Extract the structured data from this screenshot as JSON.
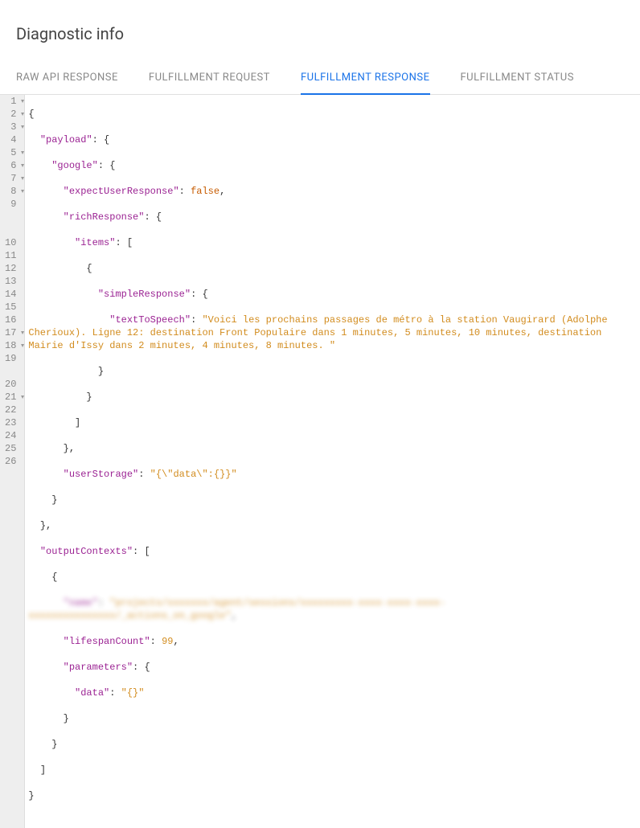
{
  "header": {
    "title": "Diagnostic info"
  },
  "tabs": [
    {
      "label": "RAW API RESPONSE",
      "active": false
    },
    {
      "label": "FULFILLMENT REQUEST",
      "active": false
    },
    {
      "label": "FULFILLMENT RESPONSE",
      "active": true
    },
    {
      "label": "FULFILLMENT STATUS",
      "active": false
    }
  ],
  "code": {
    "response": {
      "payload": {
        "google": {
          "expectUserResponse": false,
          "richResponse": {
            "items": [
              {
                "simpleResponse": {
                  "textToSpeech": "Voici les prochains passages de métro à la station Vaugirard (Adolphe Cherioux). Ligne 12: destination Front Populaire dans 1 minutes, 5 minutes, 10 minutes, destination Mairie d'Issy dans 2 minutes, 4 minutes, 8 minutes. "
                }
              }
            ]
          },
          "userStorage": "{\\\"data\\\":{}}"
        }
      },
      "outputContexts": [
        {
          "name_blurred": "projects/xxxxxxx/agent/sessions/xxxxxxxxx-xxxx-xxxx-xxxx-xxxxxxxxxxxxxxx/_actions_on_google",
          "lifespanCount": 99,
          "parameters": {
            "data": "{}"
          }
        }
      ]
    },
    "lines": [
      {
        "num": 1,
        "fold": true
      },
      {
        "num": 2,
        "fold": true
      },
      {
        "num": 3,
        "fold": true
      },
      {
        "num": 4,
        "fold": false
      },
      {
        "num": 5,
        "fold": true
      },
      {
        "num": 6,
        "fold": true
      },
      {
        "num": 7,
        "fold": true
      },
      {
        "num": 8,
        "fold": true
      },
      {
        "num": 9,
        "fold": false
      },
      {
        "num": 10,
        "fold": false
      },
      {
        "num": 11,
        "fold": false
      },
      {
        "num": 12,
        "fold": false
      },
      {
        "num": 13,
        "fold": false
      },
      {
        "num": 14,
        "fold": false
      },
      {
        "num": 15,
        "fold": false
      },
      {
        "num": 16,
        "fold": false
      },
      {
        "num": 17,
        "fold": true
      },
      {
        "num": 18,
        "fold": true
      },
      {
        "num": 19,
        "fold": false
      },
      {
        "num": 20,
        "fold": false
      },
      {
        "num": 21,
        "fold": true
      },
      {
        "num": 22,
        "fold": false
      },
      {
        "num": 23,
        "fold": false
      },
      {
        "num": 24,
        "fold": false
      },
      {
        "num": 25,
        "fold": false
      },
      {
        "num": 26,
        "fold": false
      }
    ]
  },
  "keys": {
    "payload": "payload",
    "google": "google",
    "expectUserResponse": "expectUserResponse",
    "richResponse": "richResponse",
    "items": "items",
    "simpleResponse": "simpleResponse",
    "textToSpeech": "textToSpeech",
    "userStorage": "userStorage",
    "outputContexts": "outputContexts",
    "name": "name",
    "lifespanCount": "lifespanCount",
    "parameters": "parameters",
    "data": "data"
  },
  "vals": {
    "false": "false"
  }
}
